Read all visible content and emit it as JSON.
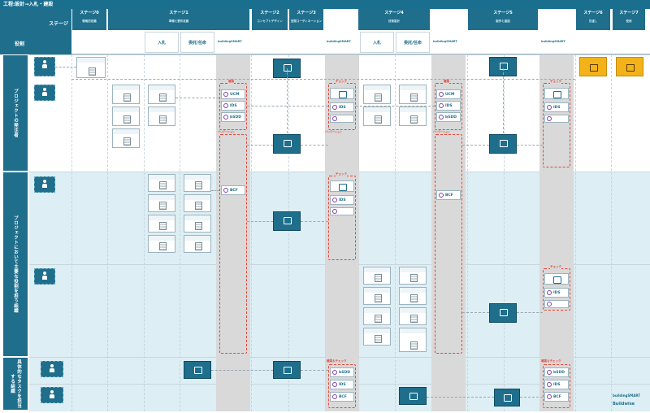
{
  "title": "工程:設計→入札・建設",
  "header": {
    "stage_row_label": "ステージ",
    "role_row_label": "役割",
    "stages": [
      {
        "label": "ステージ0",
        "sub": "戦略的定義"
      },
      {
        "label": "ステージ1",
        "sub": "準備と要件定義"
      },
      {
        "label": "ステージ2",
        "sub": "コンセプトデザイン"
      },
      {
        "label": "ステージ3",
        "sub": "空間コーディネーション"
      },
      {
        "label": "ステージ4",
        "sub": "技術設計"
      },
      {
        "label": "ステージ5",
        "sub": "製作と建設"
      },
      {
        "label": "ステージ6",
        "sub": "引渡し"
      },
      {
        "label": "ステージ7",
        "sub": "使用"
      }
    ],
    "subcolumns": {
      "bid": "入札",
      "commission": "委託/任命",
      "buildingsmart": "buildingSMART"
    }
  },
  "rows": [
    {
      "label": "プロジェクトの発注者"
    },
    {
      "label": "プロジェクトにおいて主要な役割を担う組織"
    },
    {
      "label": "具体的なタスクを担当する組織"
    }
  ],
  "labels": {
    "kakunin": "確認",
    "check": "チェック",
    "validation": "バリデーション",
    "kakunin_check": "確認＆チェック"
  },
  "badges": {
    "ucm": "UCM",
    "ids": "IDS",
    "bsdd": "bSDD",
    "bcf": "BCF"
  },
  "footer": {
    "bsmart": "buildingSMART",
    "buildwise": "Buildwise"
  },
  "colors": {
    "primary": "#1e6e8c",
    "accent": "#e0473a",
    "highlight": "#f4b21a",
    "gray_column": "#d9d9d9"
  }
}
